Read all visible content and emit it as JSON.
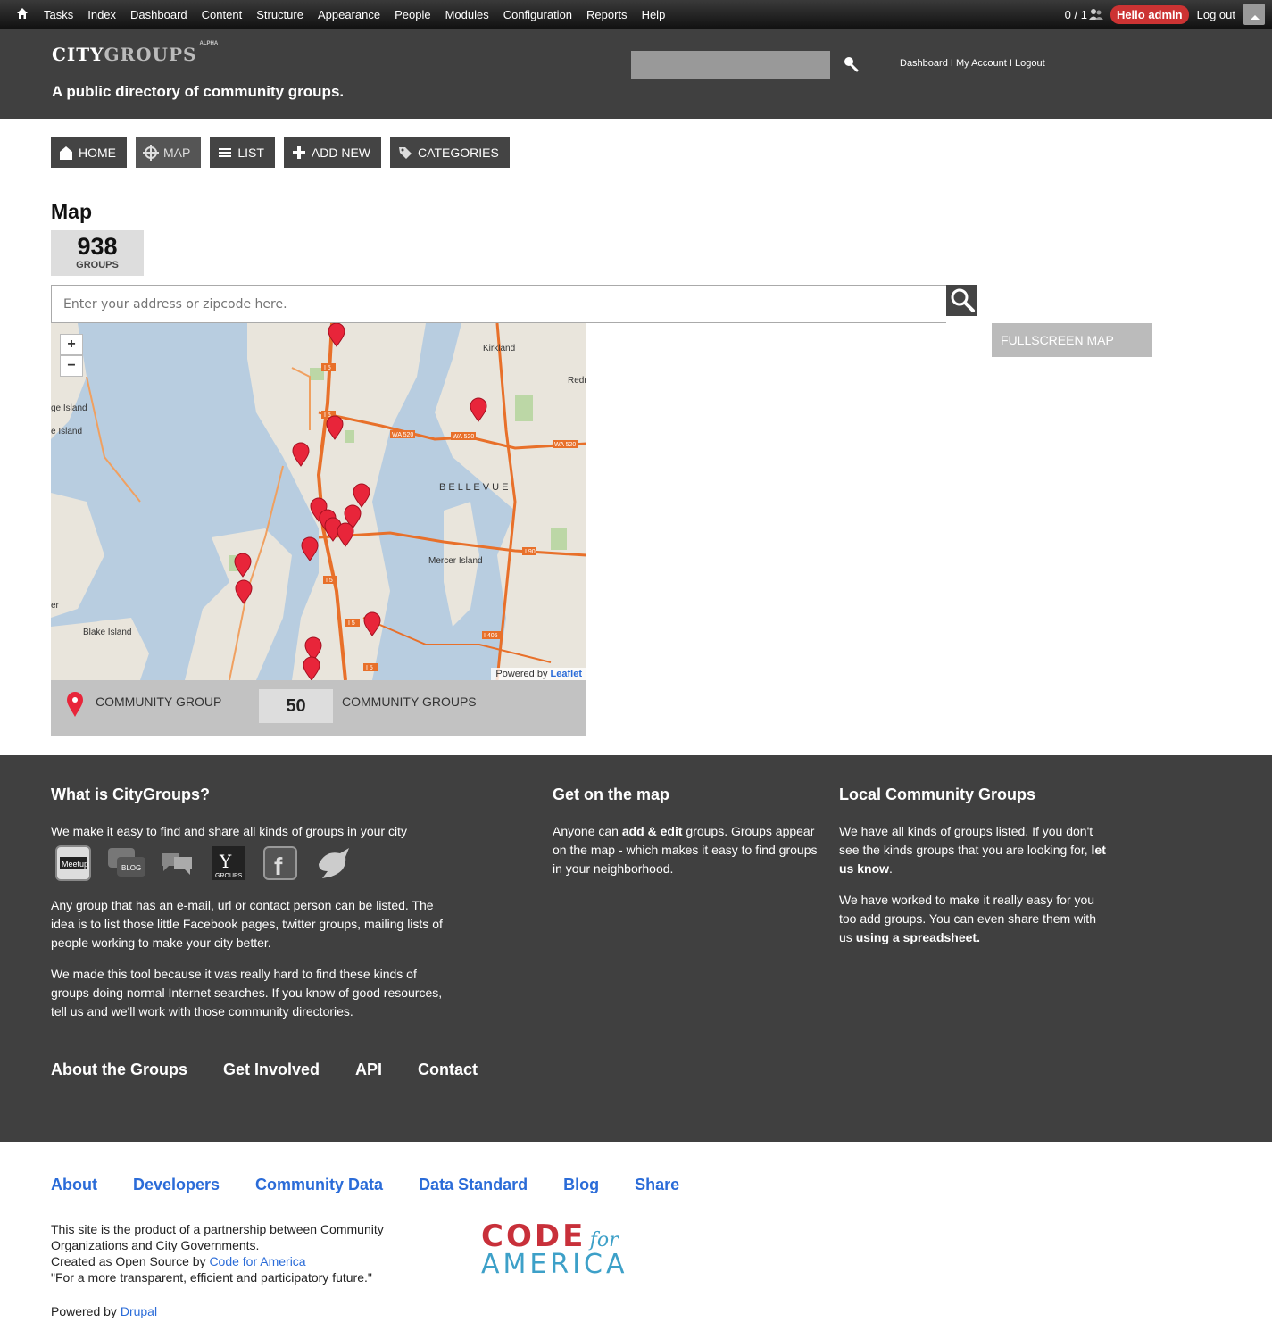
{
  "toolbar": {
    "menu": [
      "Tasks",
      "Index",
      "Dashboard",
      "Content",
      "Structure",
      "Appearance",
      "People",
      "Modules",
      "Configuration",
      "Reports",
      "Help"
    ],
    "counter": "0 / 1",
    "hello": "Hello admin",
    "logout": "Log out"
  },
  "header": {
    "logo_city": "CITY",
    "logo_groups": "GROUPS",
    "logo_badge": "ALPHA",
    "slogan": "A public directory of community groups.",
    "search_value": "",
    "user_links": "Dashboard I My Account I Logout"
  },
  "nav": {
    "home": "HOME",
    "map": "MAP",
    "list": "LIST",
    "add": "ADD NEW",
    "categories": "CATEGORIES"
  },
  "page": {
    "title": "Map",
    "count": "938",
    "count_label": "GROUPS",
    "address_placeholder": "Enter your address or zipcode here.",
    "fullscreen": "FULLSCREEN MAP"
  },
  "map": {
    "labels": {
      "kirkland": "Kirkland",
      "redmond": "Redr",
      "bainbridge1": "ge Island",
      "bainbridge2": "e Island",
      "bellevue": "B E L L E V U E",
      "mercer": "Mercer Island",
      "blake": "Blake Island",
      "er": "er"
    },
    "highways": [
      "I 5",
      "I 5",
      "WA 520",
      "WA 520",
      "WA 520",
      "I 90",
      "I 5",
      "I 5",
      "I 405",
      "I 5"
    ],
    "attribution_prefix": "Powered by ",
    "attribution_link": "Leaflet",
    "zoom_in": "+",
    "zoom_out": "−"
  },
  "legend": {
    "marker_label": "COMMUNITY GROUP",
    "count": "50",
    "count_label": "COMMUNITY GROUPS"
  },
  "footer": {
    "col1_title": "What is CityGroups?",
    "col1_intro": "We make it easy to find and share all kinds of groups in your city",
    "col1_p1": "Any group that has an e-mail, url or contact person can be listed. The idea is to list those little Facebook pages, twitter groups, mailing lists of people working to make your city better.",
    "col1_p2": "We made this tool because it was really hard to find these kinds of groups doing normal Internet searches. If you know of good resources, tell us and we'll work with those community directories.",
    "icons": [
      "meetup",
      "blog",
      "forum",
      "yahoo-groups",
      "facebook",
      "twitter"
    ],
    "icon_meetup_text": "Meetup",
    "icon_blog_text": "BLOG",
    "icon_yahoo_text": "GROUPS",
    "col2_title": "Get on the map",
    "col2_pre": "Anyone can ",
    "col2_bold": "add & edit",
    "col2_post": " groups. Groups appear on the map - which makes it easy to find groups in your neighborhood.",
    "col3_title": "Local Community Groups",
    "col3_p1": "We have all kinds of groups listed. If you don't see the kinds groups that you are looking for, ",
    "col3_p1_bold": "let us know",
    "col3_p2": "We have worked to make it really easy for you too add groups. You can even share them with us ",
    "col3_p2_bold": "using a spreadsheet.",
    "links": [
      "About the Groups",
      "Get Involved",
      "API",
      "Contact"
    ]
  },
  "footer2": {
    "links": [
      "About",
      "Developers",
      "Community Data",
      "Data Standard",
      "Blog",
      "Share"
    ],
    "credits_l1": "This site is the product of a partnership between Community",
    "credits_l2": "Organizations and City Governments.",
    "credits_l3_pre": "Created as Open Source by ",
    "credits_l3_link": "Code for America",
    "credits_l4": "\"For a more transparent, efficient and participatory future.\"",
    "powered_pre": "Powered by ",
    "powered_link": "Drupal",
    "cfa_code": "CODE",
    "cfa_for": "for",
    "cfa_america": "AMERICA"
  },
  "colors": {
    "accent_red": "#cc3333",
    "link_blue": "#2b6cd8",
    "dark_bg": "#404040",
    "marker_red": "#e8253a"
  }
}
